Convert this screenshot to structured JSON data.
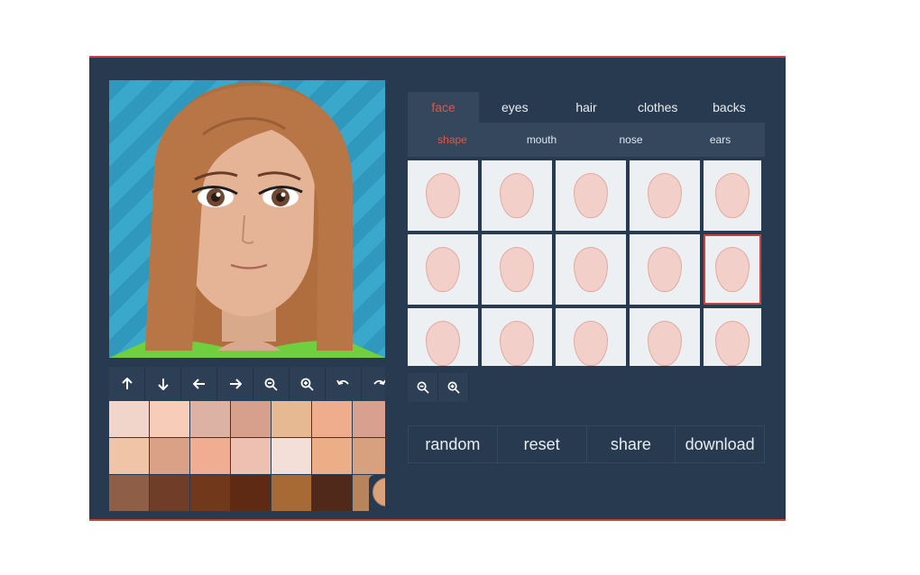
{
  "tabs": [
    {
      "label": "face",
      "active": true
    },
    {
      "label": "eyes",
      "active": false
    },
    {
      "label": "hair",
      "active": false
    },
    {
      "label": "clothes",
      "active": false
    },
    {
      "label": "backs",
      "active": false
    }
  ],
  "subtabs": [
    {
      "label": "shape",
      "active": true
    },
    {
      "label": "mouth",
      "active": false
    },
    {
      "label": "nose",
      "active": false
    },
    {
      "label": "ears",
      "active": false
    }
  ],
  "tools": [
    "arrow-up-icon",
    "arrow-down-icon",
    "arrow-left-icon",
    "arrow-right-icon",
    "zoom-out-icon",
    "zoom-in-icon",
    "undo-icon",
    "redo-icon"
  ],
  "skin_colors": [
    [
      "#f1d4ca",
      "#f7cdb9",
      "#dbb2a4",
      "#d6a08d",
      "#e6b992",
      "#efad8d",
      "#d8a08f"
    ],
    [
      "#f0c4a7",
      "#dba186",
      "#f0ad92",
      "#eec0b1",
      "#f4dfd8",
      "#ebae86",
      "#d7a17f"
    ],
    [
      "#8e5f46",
      "#6f3d28",
      "#71381b",
      "#5e2a14",
      "#a86a34",
      "#51291a",
      "#b8845c"
    ]
  ],
  "selected_skin_color": "#d9a27b",
  "face_shape_options": 15,
  "selected_option_index": 9,
  "actions": {
    "random": "random",
    "reset": "reset",
    "share": "share",
    "download": "download"
  },
  "colors": {
    "accent": "#e2554b",
    "panel": "#283a4f",
    "background_stripes": "#36a5c8"
  }
}
